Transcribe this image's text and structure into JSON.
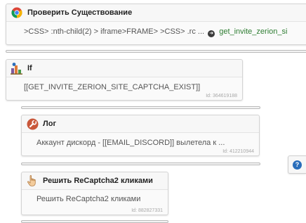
{
  "blocks": {
    "check_exists": {
      "title": "Проверить Существование",
      "selector": ">CSS> :nth-child(2) > iframe>FRAME> >CSS> .rc ...",
      "link": "get_invite_zerion_si"
    },
    "if_block": {
      "title": "If",
      "condition": "[[GET_INVITE_ZERION_SITE_CAPTCHA_EXIST]]",
      "id_label": "Id: 364619188"
    },
    "log_block": {
      "title": "Лог",
      "message": "Аккаунт дискорд - [[EMAIL_DISCORD]] вылетела к ...",
      "id_label": "Id: 412210944"
    },
    "recaptcha_block": {
      "title": "Решить ReCaptcha2 кликами",
      "description": "Решить ReCaptcha2 кликами",
      "id_label": "Id: 882827331"
    }
  },
  "help_button": {
    "label": "?"
  },
  "icons": {
    "check_exists": "chrome-icon",
    "if_block": "branch-icon",
    "log_block": "wrench-icon",
    "recaptcha_block": "hand-pointer-icon",
    "link_arrow": "arrow-right-circle-icon"
  },
  "colors": {
    "chrome_red": "#db4437",
    "chrome_green": "#0f9d58",
    "chrome_yellow": "#f4b400",
    "chrome_blue": "#4285f4",
    "log_icon_bg": "#c9573a",
    "link_green": "#2e7d32",
    "help_blue": "#2a6ebb"
  }
}
